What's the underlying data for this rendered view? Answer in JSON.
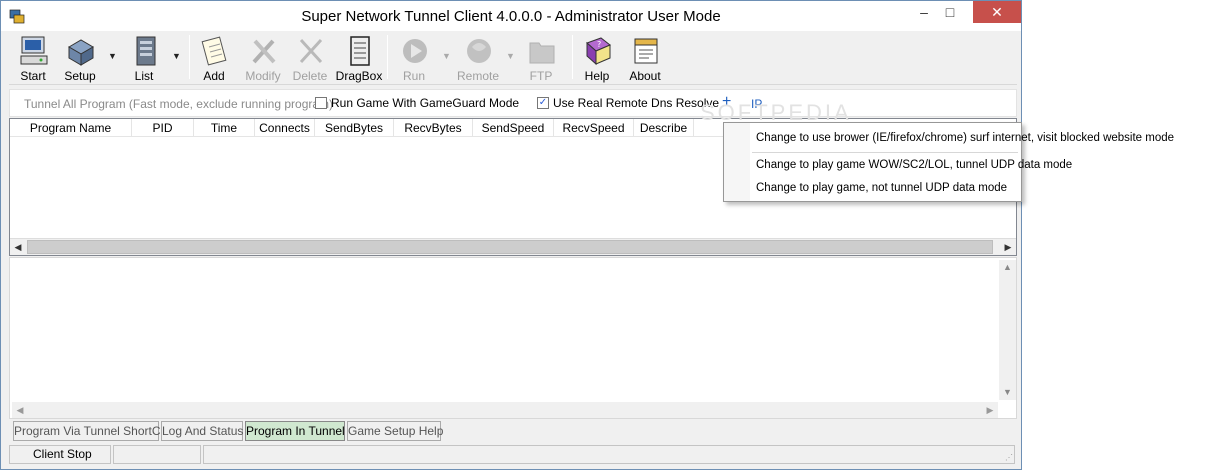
{
  "window": {
    "title": "Super Network Tunnel Client 4.0.0.0 - Administrator User Mode",
    "minimize": "–",
    "maximize": "□",
    "close": "✕"
  },
  "toolbar": {
    "buttons": [
      {
        "label": "Start",
        "icon": "computer-icon",
        "enabled": true
      },
      {
        "label": "Setup",
        "icon": "setup-box-icon",
        "enabled": true
      },
      {
        "label": "List",
        "icon": "list-icon",
        "enabled": true
      },
      {
        "label": "Add",
        "icon": "notepad-icon",
        "enabled": true
      },
      {
        "label": "Modify",
        "icon": "tools-icon",
        "enabled": false
      },
      {
        "label": "Delete",
        "icon": "delete-x-icon",
        "enabled": false
      },
      {
        "label": "DragBox",
        "icon": "dragbox-icon",
        "enabled": true
      },
      {
        "label": "Run",
        "icon": "run-icon",
        "enabled": false
      },
      {
        "label": "Remote",
        "icon": "remote-icon",
        "enabled": false
      },
      {
        "label": "FTP",
        "icon": "ftp-folder-icon",
        "enabled": false
      },
      {
        "label": "Help",
        "icon": "help-book-icon",
        "enabled": true
      },
      {
        "label": "About",
        "icon": "about-icon",
        "enabled": true
      }
    ]
  },
  "options": {
    "tunnel_all": "Tunnel All Program (Fast mode, exclude running program)",
    "gameguard": {
      "label": "Run Game With GameGuard Mode",
      "checked": false
    },
    "remote_dns": {
      "label": "Use Real Remote Dns Resolve",
      "checked": true
    },
    "plus": "+",
    "ip": "IP"
  },
  "table": {
    "columns": [
      "Program Name",
      "PID",
      "Time",
      "Connects",
      "SendBytes",
      "RecvBytes",
      "SendSpeed",
      "RecvSpeed",
      "Describe"
    ]
  },
  "tabs": [
    "Program Via Tunnel ShortCut",
    "Log And Status",
    "Program In Tunnel",
    "Game Setup Help"
  ],
  "active_tab": "Program In Tunnel",
  "status": {
    "state": "Client Stop"
  },
  "popup_menu": {
    "items": [
      "Change to use brower (IE/firefox/chrome) surf internet, visit blocked website mode",
      "Change to play game WOW/SC2/LOL, tunnel UDP data mode",
      "Change to play game, not tunnel UDP data mode"
    ]
  },
  "watermark": "SOFTPEDIA",
  "colors": {
    "close_button": "#c7504b",
    "link_blue": "#1f5fbf",
    "active_tab": "#d0e8d0"
  }
}
